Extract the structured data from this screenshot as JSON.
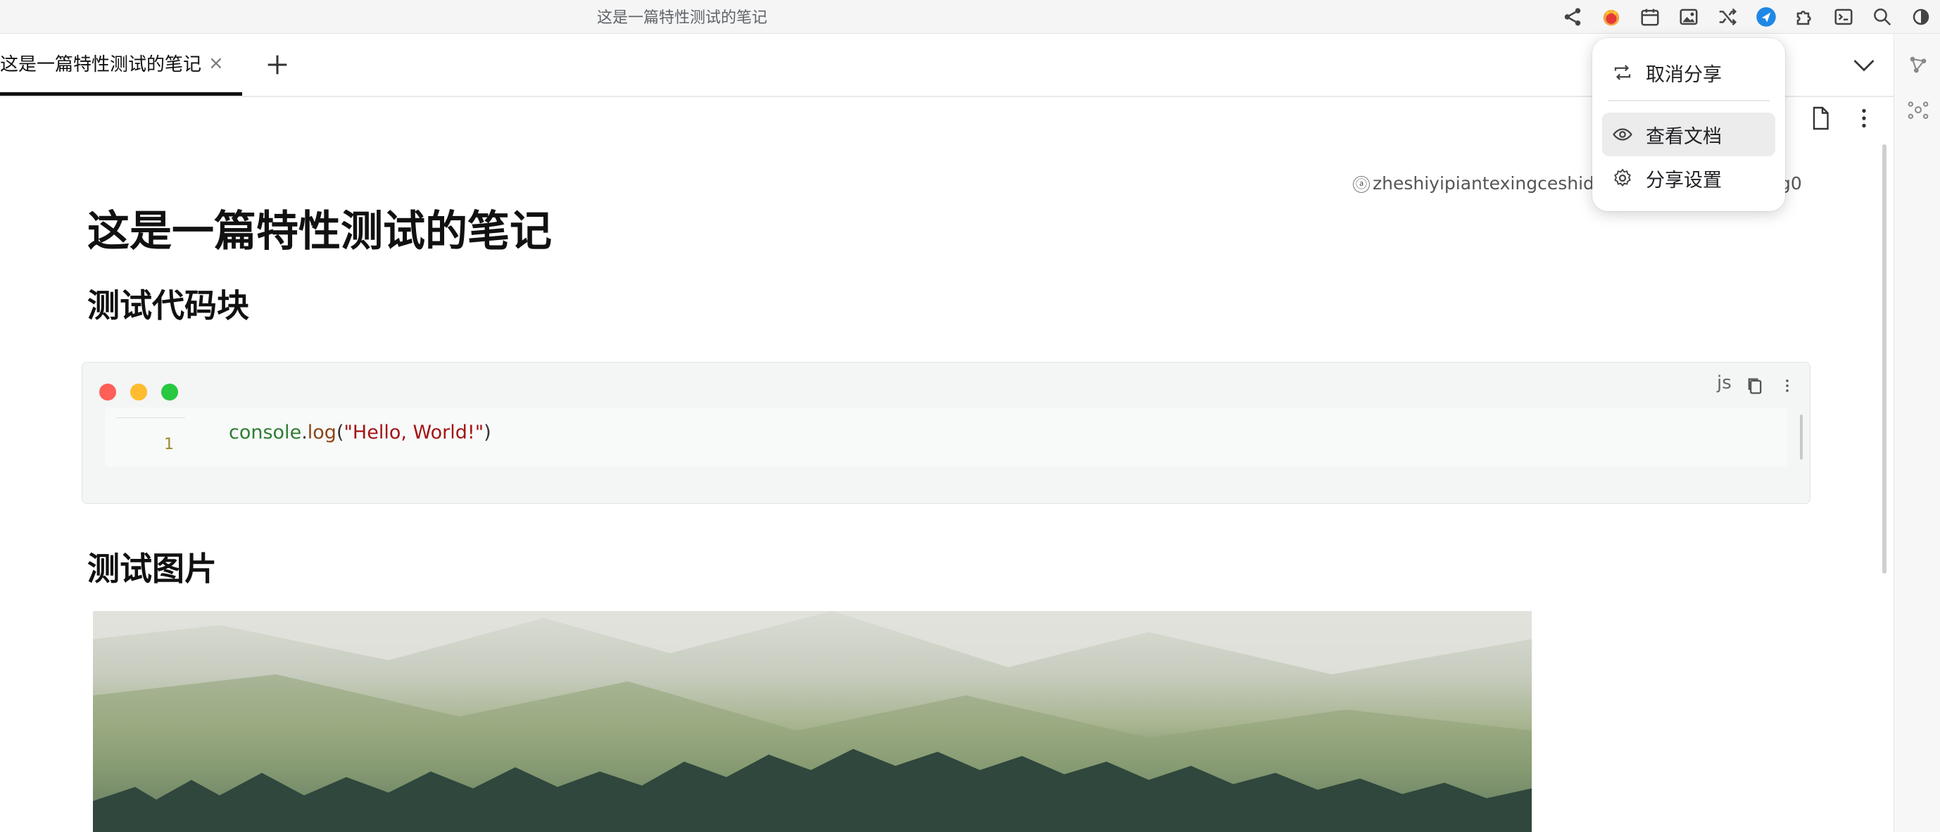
{
  "window": {
    "title": "这是一篇特性测试的笔记"
  },
  "titlebar_icons": [
    "share-icon",
    "avatar-icon",
    "calendar-icon",
    "image-icon",
    "shuffle-icon",
    "send-icon",
    "puzzle-icon",
    "terminal-icon",
    "search-icon",
    "theme-toggle-icon"
  ],
  "tabs": [
    {
      "label": "这是一篇特性测试的笔记",
      "close": "×"
    }
  ],
  "share_menu": {
    "items": [
      {
        "label": "取消分享",
        "icon": "repeat-icon"
      },
      {
        "label": "查看文档",
        "icon": "eye-icon"
      },
      {
        "label": "分享设置",
        "icon": "gear-icon"
      }
    ]
  },
  "document": {
    "share_link_prefix": "ⓐ",
    "share_link_visible": "zheshiyipiantexingceshideb",
    "share_link_tail": "g0",
    "title": "这是一篇特性测试的笔记",
    "sections": [
      {
        "heading": "测试代码块"
      },
      {
        "heading": "测试图片"
      }
    ],
    "code_block": {
      "language": "js",
      "line_number": "1",
      "tokens": {
        "object": "console",
        "dot": ".",
        "method": "log",
        "open": "(",
        "string": "\"Hello, World!\"",
        "close": ")"
      }
    }
  },
  "colors": {
    "traffic_red": "#fe5f57",
    "traffic_yellow": "#febc2e",
    "traffic_green": "#28c840",
    "accent_blue": "#1e88e5"
  }
}
